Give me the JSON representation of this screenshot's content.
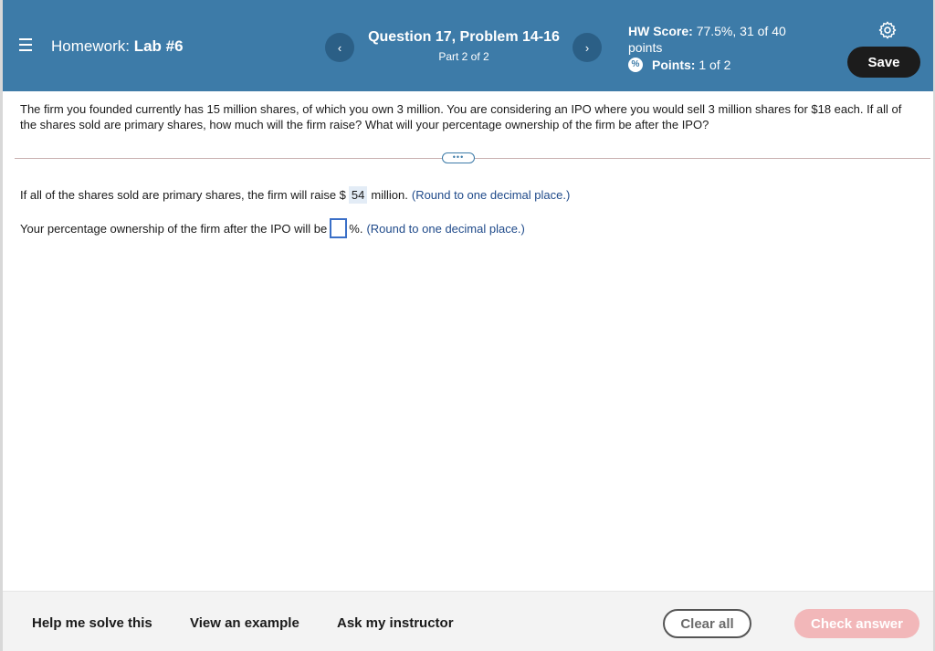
{
  "header": {
    "menu_icon": "hamburger-menu-icon",
    "homework_prefix": "Homework:",
    "homework_name": "Lab #6",
    "prev_glyph": "‹",
    "next_glyph": "›",
    "question_title": "Question 17, Problem 14-16",
    "question_part": "Part 2 of 2",
    "hw_score_label": "HW Score:",
    "hw_score_value": "77.5%, 31 of 40",
    "hw_score_suffix": "points",
    "points_icon": "partial-credit-icon",
    "points_icon_glyph": "%",
    "points_label": "Points:",
    "points_value": "1 of 2",
    "settings_icon": "gear-icon",
    "save_label": "Save"
  },
  "question": {
    "text": "The firm you founded currently has 15 million shares, of which you own 3 million. You are considering an IPO where you would sell 3 million shares for $18 each. If all of the shares sold are primary shares, how much will the firm raise? What will your percentage ownership of the firm be after the IPO?",
    "more_glyph": "•••"
  },
  "answers": {
    "line1_prefix": "If all of the shares sold are primary shares, the firm will raise $",
    "line1_value": "54",
    "line1_suffix": "million.",
    "line1_hint": "(Round to one decimal place.)",
    "line2_prefix": "Your percentage ownership of the firm after the IPO will be",
    "line2_value": "",
    "line2_suffix": "%.",
    "line2_hint": "(Round to one decimal place.)"
  },
  "footer": {
    "help_label": "Help me solve this",
    "example_label": "View an example",
    "instructor_label": "Ask my instructor",
    "clear_label": "Clear all",
    "check_label": "Check answer"
  },
  "colors": {
    "header_bg": "#3d7ba8",
    "nav_button_bg": "#2b5f86",
    "save_bg": "#1c1c1c",
    "hint_text": "#1f4a8a",
    "check_answer_bg": "#f2b7b9"
  }
}
